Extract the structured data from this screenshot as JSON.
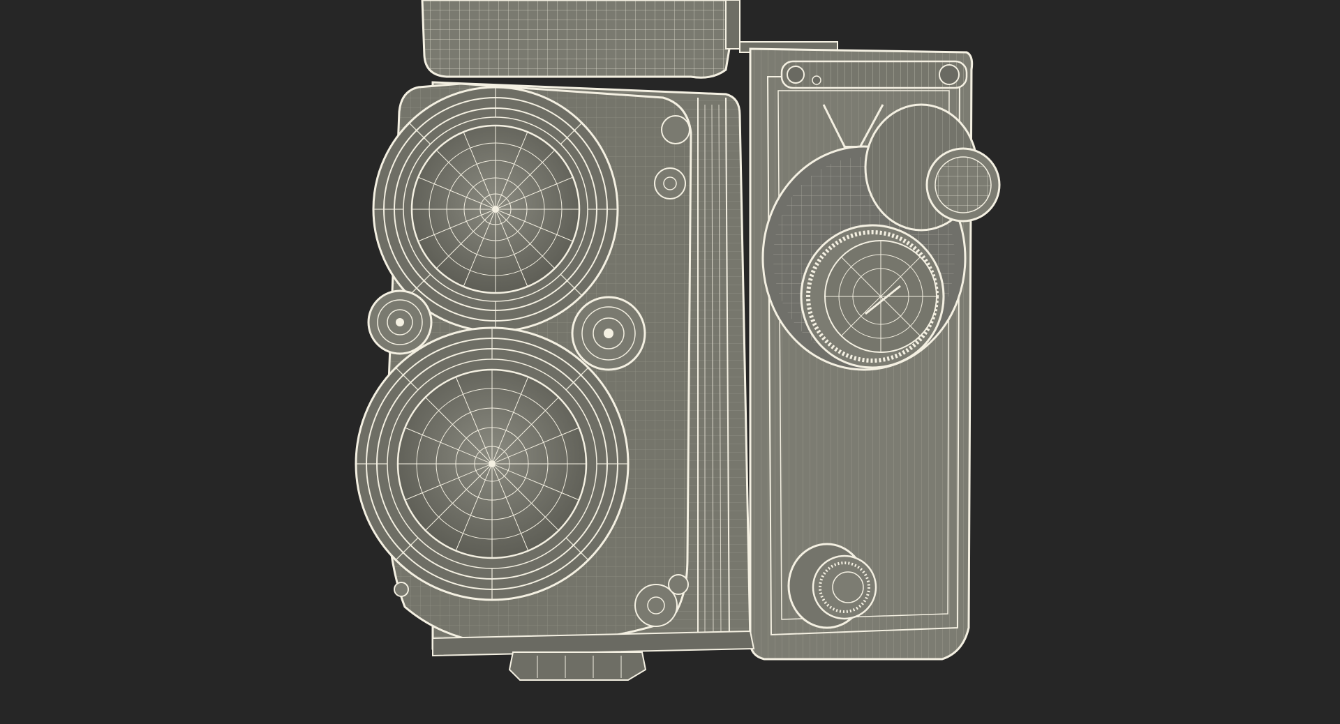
{
  "scene": {
    "subject": "twin-lens-reflex-camera-wireframe",
    "colors": {
      "background": "#262626",
      "surface": "#7e7e74",
      "surface_dark": "#5f5f57",
      "surface_light": "#9a9a8e",
      "wire": "#f4f0e2"
    }
  }
}
